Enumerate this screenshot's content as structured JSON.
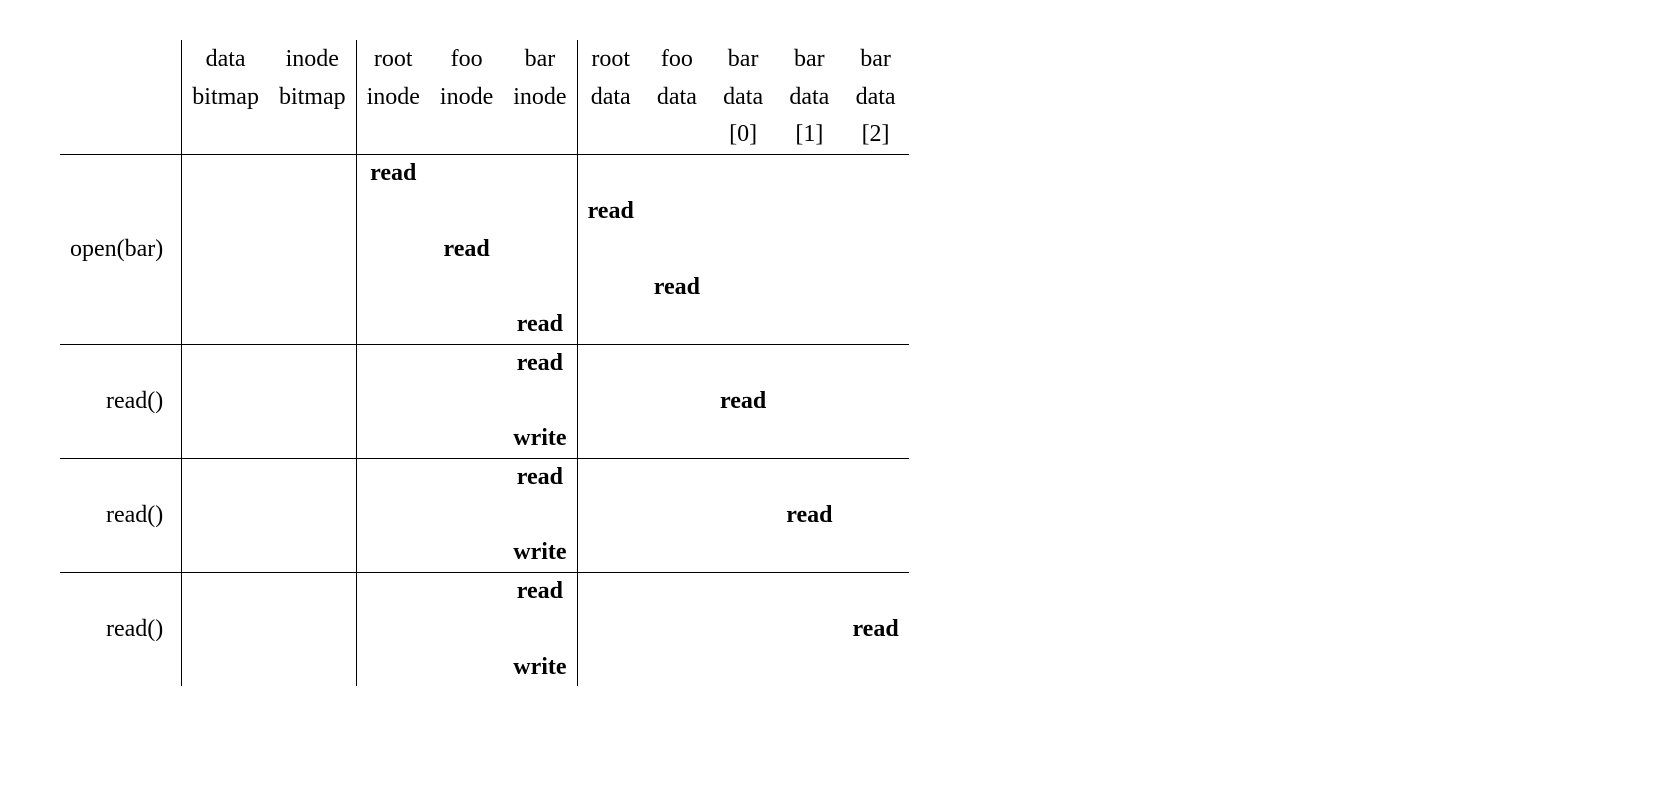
{
  "columns": {
    "c0": "",
    "c1_l1": "data",
    "c1_l2": "bitmap",
    "c1_l3": "",
    "c2_l1": "inode",
    "c2_l2": "bitmap",
    "c2_l3": "",
    "c3_l1": "root",
    "c3_l2": "inode",
    "c3_l3": "",
    "c4_l1": "foo",
    "c4_l2": "inode",
    "c4_l3": "",
    "c5_l1": "bar",
    "c5_l2": "inode",
    "c5_l3": "",
    "c6_l1": "root",
    "c6_l2": "data",
    "c6_l3": "",
    "c7_l1": "foo",
    "c7_l2": "data",
    "c7_l3": "",
    "c8_l1": "bar",
    "c8_l2": "data",
    "c8_l3": "[0]",
    "c9_l1": "bar",
    "c9_l2": "data",
    "c9_l3": "[1]",
    "c10_l1": "bar",
    "c10_l2": "data",
    "c10_l3": "[2]"
  },
  "row_labels": {
    "open": "open(bar)",
    "read1": "read()",
    "read2": "read()",
    "read3": "read()"
  },
  "ops": {
    "read": "read",
    "write": "write"
  }
}
